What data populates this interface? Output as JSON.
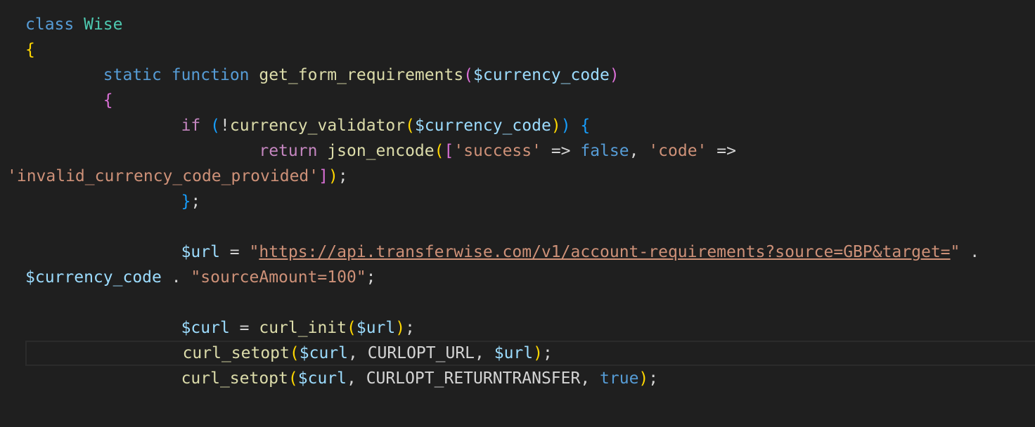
{
  "editor": {
    "lines": [
      {
        "indent": "",
        "tokens": [
          {
            "t": "class",
            "c": "kw"
          },
          {
            "t": " ",
            "c": "plain"
          },
          {
            "t": "Wise",
            "c": "cls"
          }
        ]
      },
      {
        "indent": "",
        "tokens": [
          {
            "t": "{",
            "c": "b1"
          }
        ]
      },
      {
        "indent": "        ",
        "tokens": [
          {
            "t": "static",
            "c": "kw"
          },
          {
            "t": " ",
            "c": "plain"
          },
          {
            "t": "function",
            "c": "kw"
          },
          {
            "t": " ",
            "c": "plain"
          },
          {
            "t": "get_form_requirements",
            "c": "fn"
          },
          {
            "t": "(",
            "c": "b2"
          },
          {
            "t": "$currency_code",
            "c": "var"
          },
          {
            "t": ")",
            "c": "b2"
          }
        ]
      },
      {
        "indent": "        ",
        "tokens": [
          {
            "t": "{",
            "c": "b2"
          }
        ]
      },
      {
        "indent": "                ",
        "tokens": [
          {
            "t": "if",
            "c": "ctl"
          },
          {
            "t": " ",
            "c": "plain"
          },
          {
            "t": "(",
            "c": "b3"
          },
          {
            "t": "!",
            "c": "plain"
          },
          {
            "t": "currency_validator",
            "c": "fn"
          },
          {
            "t": "(",
            "c": "b1"
          },
          {
            "t": "$currency_code",
            "c": "var"
          },
          {
            "t": ")",
            "c": "b1"
          },
          {
            "t": ")",
            "c": "b3"
          },
          {
            "t": " ",
            "c": "plain"
          },
          {
            "t": "{",
            "c": "b3"
          }
        ]
      },
      {
        "indent": "                        ",
        "tokens": [
          {
            "t": "return",
            "c": "ctl"
          },
          {
            "t": " ",
            "c": "plain"
          },
          {
            "t": "json_encode",
            "c": "fn"
          },
          {
            "t": "(",
            "c": "b1"
          },
          {
            "t": "[",
            "c": "b2"
          },
          {
            "t": "'success'",
            "c": "str"
          },
          {
            "t": " => ",
            "c": "plain"
          },
          {
            "t": "false",
            "c": "kw"
          },
          {
            "t": ", ",
            "c": "plain"
          },
          {
            "t": "'code'",
            "c": "str"
          },
          {
            "t": " =>",
            "c": "plain"
          }
        ]
      },
      {
        "indent": "",
        "tokens": [
          {
            "t": "'invalid_currency_code_provided'",
            "c": "str"
          },
          {
            "t": "]",
            "c": "b2"
          },
          {
            "t": ")",
            "c": "b1"
          },
          {
            "t": ";",
            "c": "plain"
          }
        ]
      },
      {
        "indent": "                ",
        "tokens": [
          {
            "t": "}",
            "c": "b3"
          },
          {
            "t": ";",
            "c": "plain"
          }
        ]
      },
      {
        "indent": "",
        "tokens": []
      },
      {
        "indent": "                ",
        "tokens": [
          {
            "t": "$url",
            "c": "var"
          },
          {
            "t": " = ",
            "c": "plain"
          },
          {
            "t": "\"",
            "c": "str"
          },
          {
            "t": "https://api.transferwise.com/v1/account-requirements?source=GBP&target=",
            "c": "link"
          },
          {
            "t": "\"",
            "c": "str"
          },
          {
            "t": " .",
            "c": "plain"
          }
        ]
      },
      {
        "indent": "",
        "tokens": [
          {
            "t": "$currency_code",
            "c": "var"
          },
          {
            "t": " . ",
            "c": "plain"
          },
          {
            "t": "\"sourceAmount=100\"",
            "c": "str"
          },
          {
            "t": ";",
            "c": "plain"
          }
        ]
      },
      {
        "indent": "",
        "tokens": []
      },
      {
        "indent": "                ",
        "tokens": [
          {
            "t": "$curl",
            "c": "var"
          },
          {
            "t": " = ",
            "c": "plain"
          },
          {
            "t": "curl_init",
            "c": "fn"
          },
          {
            "t": "(",
            "c": "b1"
          },
          {
            "t": "$url",
            "c": "var"
          },
          {
            "t": ")",
            "c": "b1"
          },
          {
            "t": ";",
            "c": "plain"
          }
        ]
      },
      {
        "indent": "                ",
        "tokens": [
          {
            "t": "curl_setopt",
            "c": "fn"
          },
          {
            "t": "(",
            "c": "b1"
          },
          {
            "t": "$curl",
            "c": "var"
          },
          {
            "t": ", CURLOPT_URL, ",
            "c": "plain"
          },
          {
            "t": "$url",
            "c": "var"
          },
          {
            "t": ")",
            "c": "b1"
          },
          {
            "t": ";",
            "c": "plain"
          }
        ]
      },
      {
        "indent": "                ",
        "tokens": [
          {
            "t": "curl_setopt",
            "c": "fn"
          },
          {
            "t": "(",
            "c": "b1"
          },
          {
            "t": "$curl",
            "c": "var"
          },
          {
            "t": ", CURLOPT_RETURNTRANSFER, ",
            "c": "plain"
          },
          {
            "t": "true",
            "c": "kw"
          },
          {
            "t": ")",
            "c": "b1"
          },
          {
            "t": ";",
            "c": "plain"
          }
        ]
      }
    ]
  }
}
